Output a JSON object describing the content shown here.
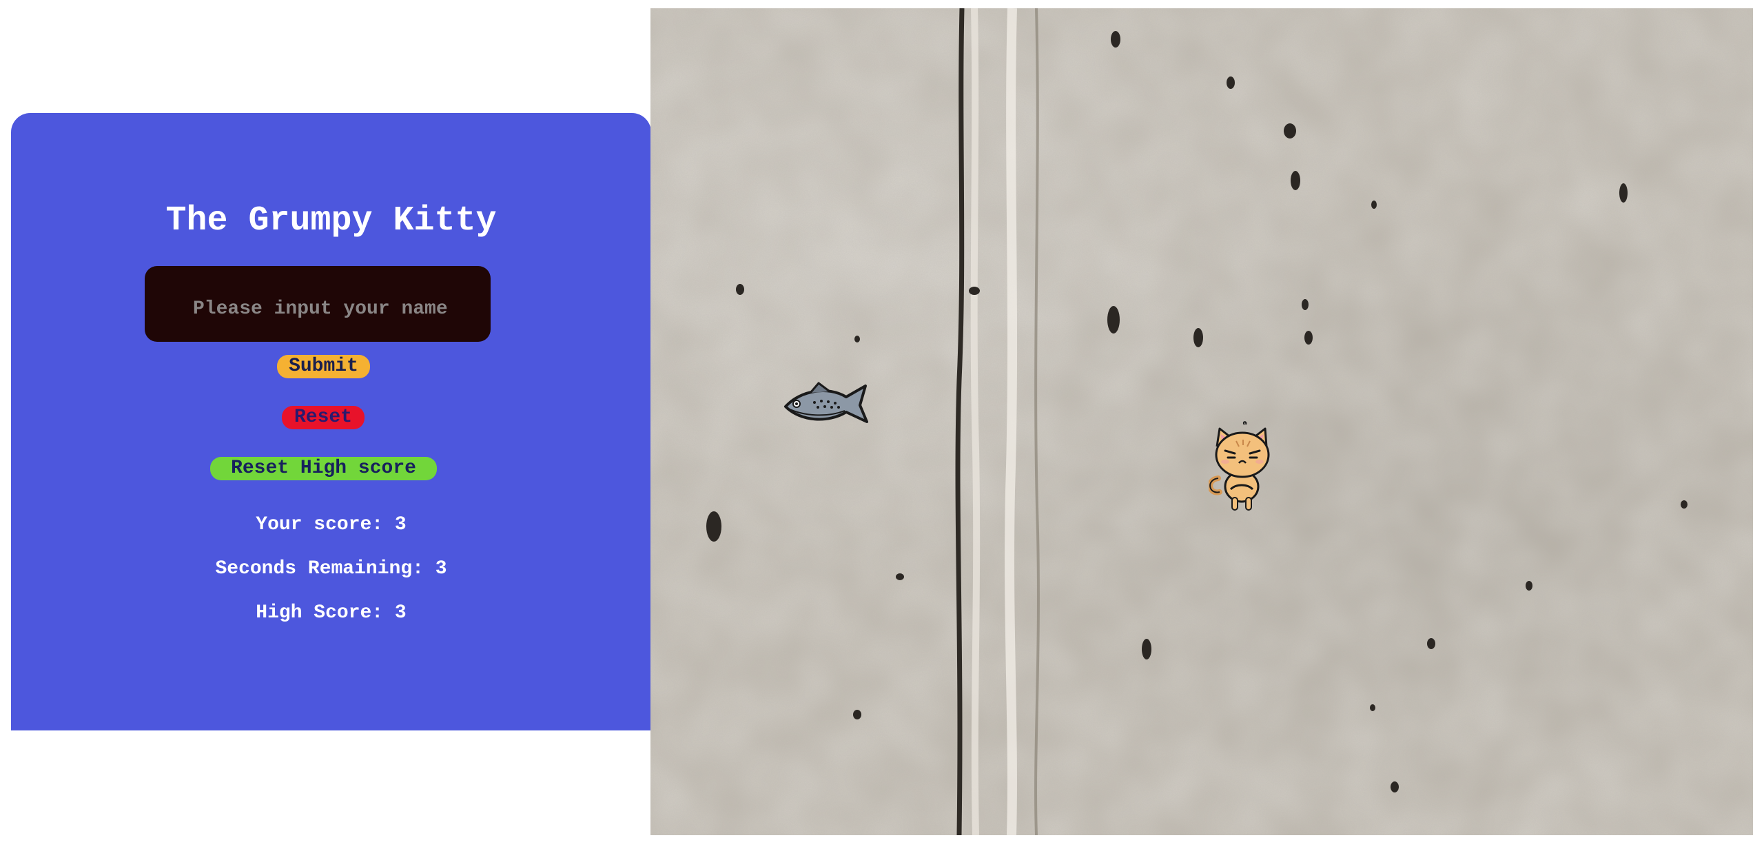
{
  "panel": {
    "title": "The Grumpy Kitty",
    "name_input": {
      "placeholder": "Please input your name",
      "value": ""
    },
    "buttons": {
      "submit_label": "Submit",
      "reset_label": "Reset",
      "reset_high_label": "Reset High score"
    },
    "stats": {
      "score_text": "Your score: 3",
      "seconds_text": "Seconds Remaining: 3",
      "high_score_text": "High Score: 3"
    },
    "colors": {
      "panel_bg": "#4d57dd",
      "input_bg": "#1f0606",
      "submit_bg": "#f5b132",
      "reset_bg": "#e8122a",
      "reset_high_bg": "#72d63a"
    }
  },
  "game": {
    "background": "concrete-wall-texture",
    "sprites": [
      {
        "name": "fish",
        "icon": "fish-icon"
      },
      {
        "name": "kitty",
        "icon": "grumpy-cat-icon"
      }
    ]
  }
}
